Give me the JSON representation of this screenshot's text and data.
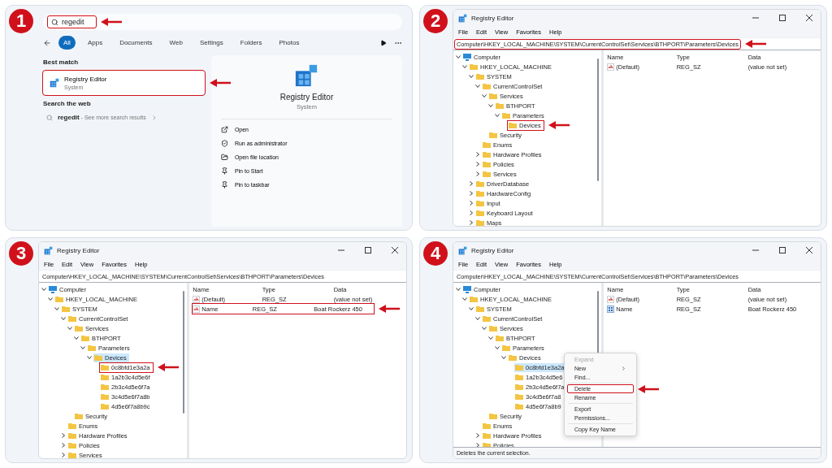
{
  "steps": [
    {
      "number": "1",
      "kind": "search",
      "search": {
        "value": "regedit",
        "highlighted": true
      },
      "filters": [
        {
          "label": "All",
          "selected": true
        },
        {
          "label": "Apps",
          "selected": false
        },
        {
          "label": "Documents",
          "selected": false
        },
        {
          "label": "Web",
          "selected": false
        },
        {
          "label": "Settings",
          "selected": false
        },
        {
          "label": "Folders",
          "selected": false
        },
        {
          "label": "Photos",
          "selected": false
        }
      ],
      "best_match": {
        "heading": "Best match",
        "title": "Registry Editor",
        "subtitle": "System",
        "highlighted": true
      },
      "web": {
        "heading": "Search the web",
        "result": "**regedit** - See more search results"
      },
      "preview": {
        "title": "Registry Editor",
        "subtitle": "System",
        "actions": [
          "Open",
          "Run as administrator",
          "Open file location",
          "Pin to Start",
          "Pin to taskbar"
        ]
      }
    },
    {
      "number": "2",
      "kind": "registry",
      "title": "Registry Editor",
      "menu": [
        "File",
        "Edit",
        "View",
        "Favorites",
        "Help"
      ],
      "address": {
        "path": "Computer\\HKEY_LOCAL_MACHINE\\SYSTEM\\CurrentControlSet\\Services\\BTHPORT\\Parameters\\Devices",
        "highlighted": true
      },
      "tree": [
        {
          "label": "Computer",
          "expanded": true,
          "selected": false,
          "highlighted": false,
          "children": [
            {
              "label": "HKEY_LOCAL_MACHINE",
              "expanded": true,
              "selected": false,
              "highlighted": false,
              "children": [
                {
                  "label": "SYSTEM",
                  "expanded": true,
                  "selected": false,
                  "highlighted": false,
                  "children": [
                    {
                      "label": "CurrentControlSet",
                      "expanded": true,
                      "selected": false,
                      "highlighted": false,
                      "children": [
                        {
                          "label": "Services",
                          "expanded": true,
                          "selected": false,
                          "highlighted": false,
                          "children": [
                            {
                              "label": "BTHPORT",
                              "expanded": true,
                              "selected": false,
                              "highlighted": false,
                              "children": [
                                {
                                  "label": "Parameters",
                                  "expanded": true,
                                  "selected": false,
                                  "highlighted": false,
                                  "children": [
                                    {
                                      "label": "Devices",
                                      "selected": false,
                                      "highlighted": true
                                    }
                                  ]
                                }
                              ]
                            }
                          ]
                        },
                        {
                          "label": "Security",
                          "selected": false,
                          "highlighted": false
                        }
                      ]
                    },
                    {
                      "label": "Enums",
                      "selected": false,
                      "highlighted": false
                    },
                    {
                      "label": "Hardware Profiles",
                      "expanded": false,
                      "selected": false,
                      "highlighted": false
                    },
                    {
                      "label": "Policies",
                      "expanded": false,
                      "selected": false,
                      "highlighted": false
                    },
                    {
                      "label": "Services",
                      "expanded": false,
                      "selected": false,
                      "highlighted": false
                    }
                  ]
                },
                {
                  "label": "DriverDatabase",
                  "expanded": false,
                  "selected": false,
                  "highlighted": false
                },
                {
                  "label": "HardwareConfig",
                  "expanded": false,
                  "selected": false,
                  "highlighted": false
                },
                {
                  "label": "Input",
                  "expanded": false,
                  "selected": false,
                  "highlighted": false
                },
                {
                  "label": "Keyboard Layout",
                  "expanded": false,
                  "selected": false,
                  "highlighted": false
                },
                {
                  "label": "Maps",
                  "expanded": false,
                  "selected": false,
                  "highlighted": false
                }
              ]
            }
          ]
        }
      ],
      "columns": [
        "Name",
        "Type",
        "Data"
      ],
      "values": [
        {
          "name": "(Default)",
          "type": "REG_SZ",
          "data": "(value not set)",
          "kind": "string",
          "highlighted": false
        }
      ]
    },
    {
      "number": "3",
      "kind": "registry",
      "title": "Registry Editor",
      "menu": [
        "File",
        "Edit",
        "View",
        "Favorites",
        "Help"
      ],
      "address": {
        "path": "Computer\\HKEY_LOCAL_MACHINE\\SYSTEM\\CurrentControlSet\\Services\\BTHPORT\\Parameters\\Devices",
        "highlighted": false
      },
      "tree": [
        {
          "label": "Computer",
          "expanded": true,
          "selected": false,
          "highlighted": false,
          "children": [
            {
              "label": "HKEY_LOCAL_MACHINE",
              "expanded": true,
              "selected": false,
              "highlighted": false,
              "children": [
                {
                  "label": "SYSTEM",
                  "expanded": true,
                  "selected": false,
                  "highlighted": false,
                  "children": [
                    {
                      "label": "CurrentControlSet",
                      "expanded": true,
                      "selected": false,
                      "highlighted": false,
                      "children": [
                        {
                          "label": "Services",
                          "expanded": true,
                          "selected": false,
                          "highlighted": false,
                          "children": [
                            {
                              "label": "BTHPORT",
                              "expanded": true,
                              "selected": false,
                              "highlighted": false,
                              "children": [
                                {
                                  "label": "Parameters",
                                  "expanded": true,
                                  "selected": false,
                                  "highlighted": false,
                                  "children": [
                                    {
                                      "label": "Devices",
                                      "expanded": true,
                                      "selected": true,
                                      "highlighted": false,
                                      "children": [
                                        {
                                          "label": "0c8bfd1e3a2a",
                                          "selected": false,
                                          "highlighted": true
                                        },
                                        {
                                          "label": "1a2b3c4d5e6f",
                                          "selected": false,
                                          "highlighted": false
                                        },
                                        {
                                          "label": "2b3c4d5e6f7a",
                                          "selected": false,
                                          "highlighted": false
                                        },
                                        {
                                          "label": "3c4d5e6f7a8b",
                                          "selected": false,
                                          "highlighted": false
                                        },
                                        {
                                          "label": "4d5e6f7a8b9c",
                                          "selected": false,
                                          "highlighted": false
                                        }
                                      ]
                                    }
                                  ]
                                }
                              ]
                            }
                          ]
                        },
                        {
                          "label": "Security",
                          "selected": false,
                          "highlighted": false
                        }
                      ]
                    },
                    {
                      "label": "Enums",
                      "selected": false,
                      "highlighted": false
                    },
                    {
                      "label": "Hardware Profiles",
                      "expanded": false,
                      "selected": false,
                      "highlighted": false
                    },
                    {
                      "label": "Policies",
                      "expanded": false,
                      "selected": false,
                      "highlighted": false
                    },
                    {
                      "label": "Services",
                      "expanded": false,
                      "selected": false,
                      "highlighted": false
                    }
                  ]
                }
              ]
            }
          ]
        }
      ],
      "columns": [
        "Name",
        "Type",
        "Data"
      ],
      "values": [
        {
          "name": "(Default)",
          "type": "REG_SZ",
          "data": "(value not set)",
          "kind": "string",
          "highlighted": false
        },
        {
          "name": "Name",
          "type": "REG_SZ",
          "data": "Boat Rockerz 450",
          "kind": "string",
          "highlighted": true
        }
      ]
    },
    {
      "number": "4",
      "kind": "registry",
      "title": "Registry Editor",
      "menu": [
        "File",
        "Edit",
        "View",
        "Favorites",
        "Help"
      ],
      "address": {
        "path": "Computer\\HKEY_LOCAL_MACHINE\\SYSTEM\\CurrentControlSet\\Services\\BTHPORT\\Parameters\\Devices",
        "highlighted": false
      },
      "tree": [
        {
          "label": "Computer",
          "expanded": true,
          "selected": false,
          "highlighted": false,
          "children": [
            {
              "label": "HKEY_LOCAL_MACHINE",
              "expanded": true,
              "selected": false,
              "highlighted": false,
              "children": [
                {
                  "label": "SYSTEM",
                  "expanded": true,
                  "selected": false,
                  "highlighted": false,
                  "children": [
                    {
                      "label": "CurrentControlSet",
                      "expanded": true,
                      "selected": false,
                      "highlighted": false,
                      "children": [
                        {
                          "label": "Services",
                          "expanded": true,
                          "selected": false,
                          "highlighted": false,
                          "children": [
                            {
                              "label": "BTHPORT",
                              "expanded": true,
                              "selected": false,
                              "highlighted": false,
                              "children": [
                                {
                                  "label": "Parameters",
                                  "expanded": true,
                                  "selected": false,
                                  "highlighted": false,
                                  "children": [
                                    {
                                      "label": "Devices",
                                      "expanded": true,
                                      "selected": false,
                                      "highlighted": false,
                                      "children": [
                                        {
                                          "label": "0c8bfd1e3a2a",
                                          "selected": true,
                                          "highlighted": false
                                        },
                                        {
                                          "label": "1a2b3c4d5e6",
                                          "selected": false,
                                          "highlighted": false
                                        },
                                        {
                                          "label": "2b3c4d5e6f7a",
                                          "selected": false,
                                          "highlighted": false
                                        },
                                        {
                                          "label": "3c4d5e6f7a8",
                                          "selected": false,
                                          "highlighted": false
                                        },
                                        {
                                          "label": "4d5e6f7a8b9",
                                          "selected": false,
                                          "highlighted": false
                                        }
                                      ]
                                    }
                                  ]
                                }
                              ]
                            }
                          ]
                        },
                        {
                          "label": "Security",
                          "selected": false,
                          "highlighted": false
                        }
                      ]
                    },
                    {
                      "label": "Enums",
                      "selected": false,
                      "highlighted": false
                    },
                    {
                      "label": "Hardware Profiles",
                      "expanded": false,
                      "selected": false,
                      "highlighted": false
                    },
                    {
                      "label": "Policies",
                      "expanded": false,
                      "selected": false,
                      "highlighted": false
                    }
                  ]
                }
              ]
            }
          ]
        }
      ],
      "columns": [
        "Name",
        "Type",
        "Data"
      ],
      "values": [
        {
          "name": "(Default)",
          "type": "REG_SZ",
          "data": "(value not set)",
          "kind": "string",
          "highlighted": false
        },
        {
          "name": "Name",
          "type": "REG_SZ",
          "data": "Boat Rockerz 450",
          "kind": "binary",
          "highlighted": false
        }
      ],
      "context_menu": {
        "groups": [
          [
            {
              "label": "Expand",
              "disabled": true,
              "submenu": false,
              "highlighted": false
            },
            {
              "label": "New",
              "disabled": false,
              "submenu": true,
              "highlighted": false
            },
            {
              "label": "Find...",
              "disabled": false,
              "submenu": false,
              "highlighted": false
            }
          ],
          [
            {
              "label": "Delete",
              "disabled": false,
              "submenu": false,
              "highlighted": true
            },
            {
              "label": "Rename",
              "disabled": false,
              "submenu": false,
              "highlighted": false
            }
          ],
          [
            {
              "label": "Export",
              "disabled": false,
              "submenu": false,
              "highlighted": false
            },
            {
              "label": "Permissions...",
              "disabled": false,
              "submenu": false,
              "highlighted": false
            }
          ],
          [
            {
              "label": "Copy Key Name",
              "disabled": false,
              "submenu": false,
              "highlighted": false
            }
          ]
        ]
      },
      "status_bar": "Deletes the current selection."
    }
  ]
}
